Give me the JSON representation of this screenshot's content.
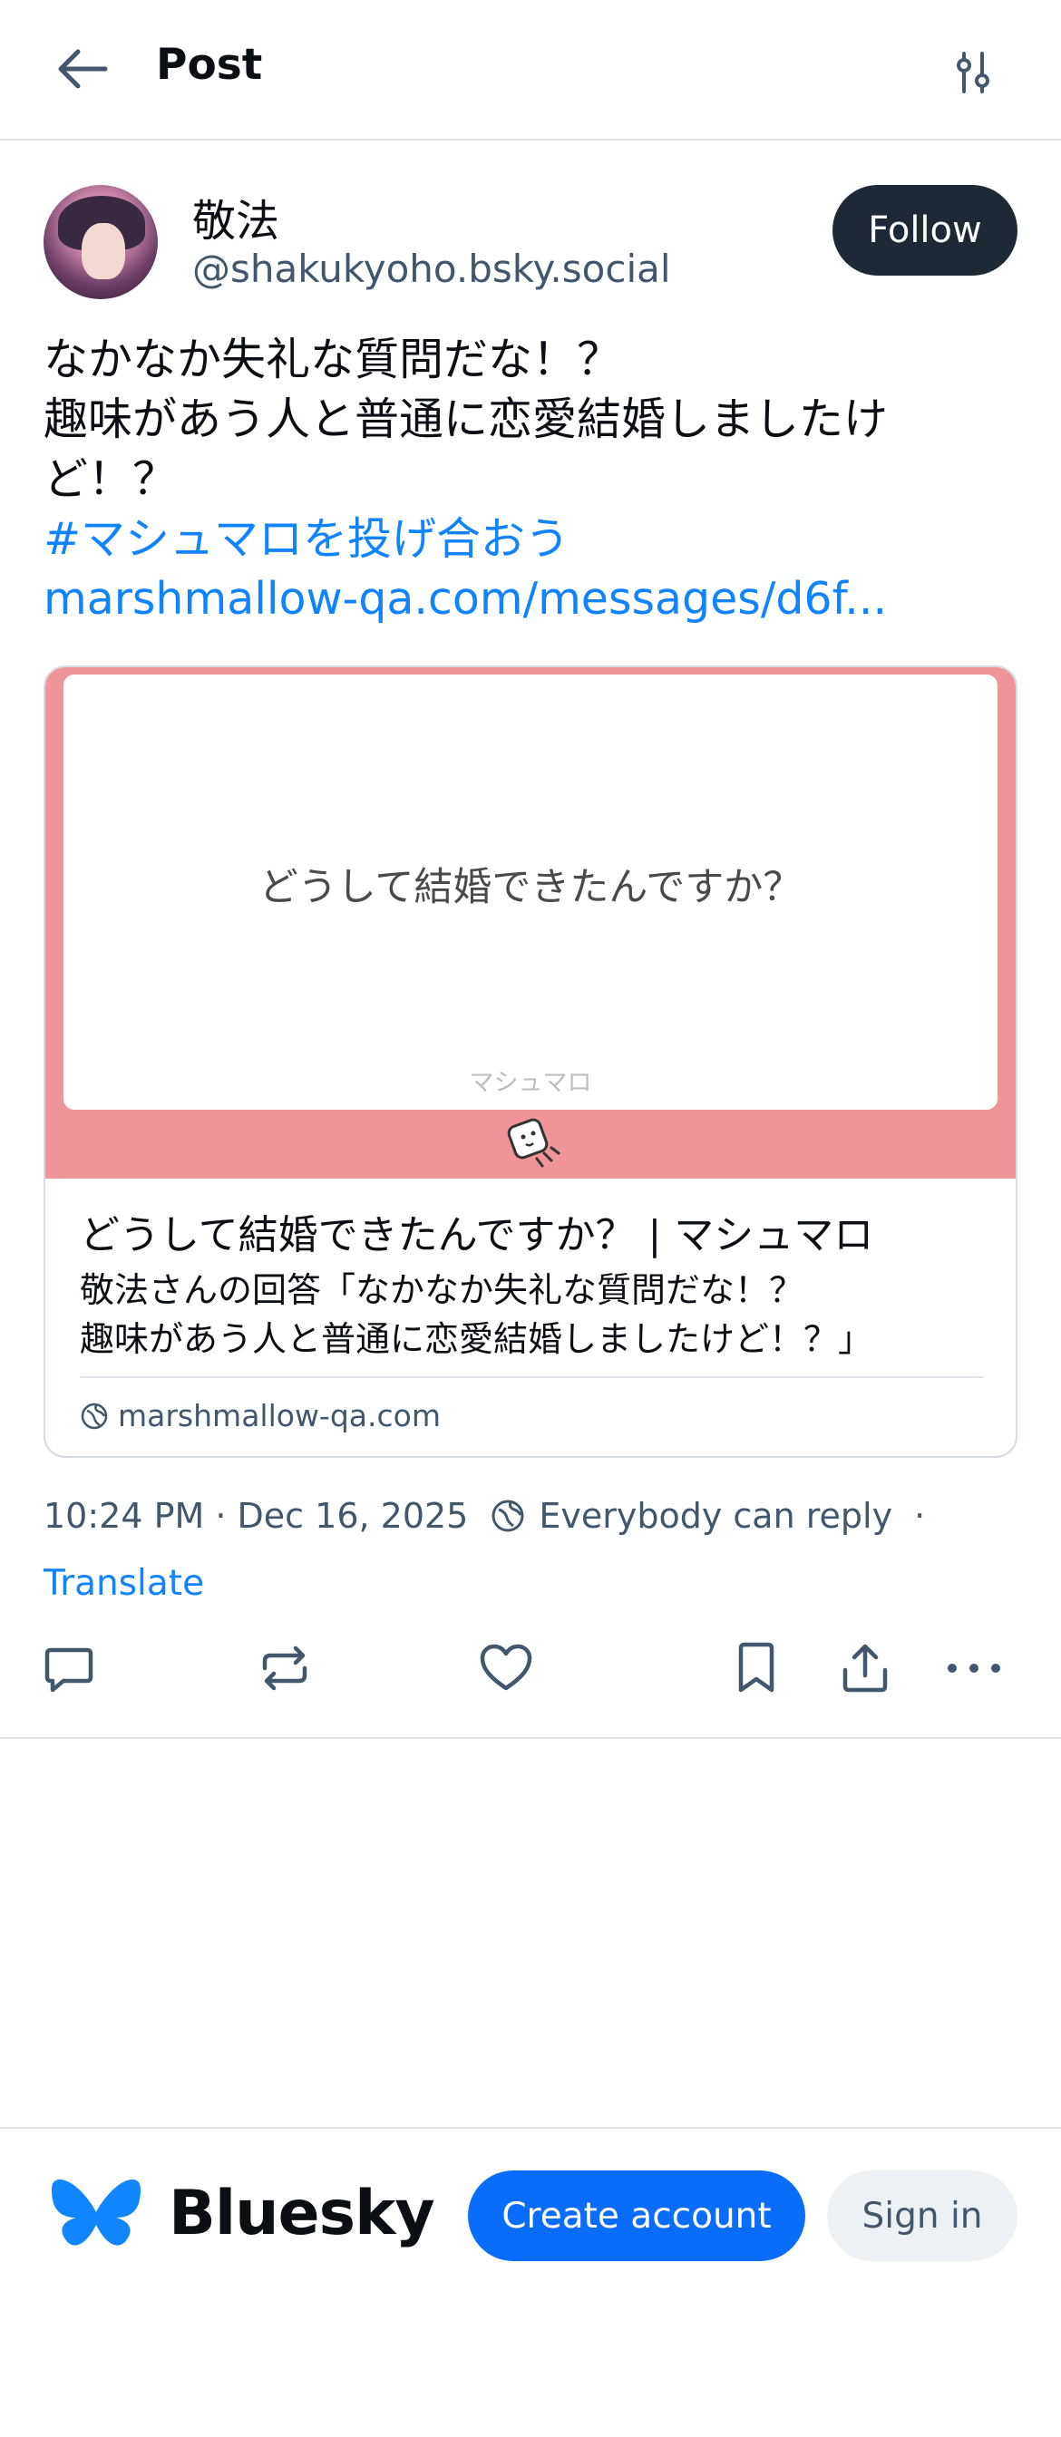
{
  "header": {
    "title": "Post",
    "back_icon": "arrow-left-icon",
    "filter_icon": "sliders-icon"
  },
  "author": {
    "display_name": "敬法",
    "handle": "@shakukyoho.bsky.social",
    "follow_label": "Follow"
  },
  "post": {
    "lines": [
      "なかなか失礼な質問だな！？",
      "趣味があう人と普通に恋愛結婚しましたけ",
      "ど！？"
    ],
    "hashtag": "#マシュマロを投げ合おう",
    "link": "marshmallow-qa.com/messages/d6f..."
  },
  "link_card": {
    "image_question": "どうして結婚できたんですか？",
    "image_brand": "マシュマロ",
    "title": "どうして結婚できたんですか？ | マシュマロ",
    "description_lines": [
      "敬法さんの回答「なかなか失礼な質問だな！？",
      "趣味があう人と普通に恋愛結婚しましたけど！？」"
    ],
    "domain": "marshmallow-qa.com"
  },
  "meta": {
    "timestamp": "10:24 PM · Dec 16, 2025",
    "reply_setting": "Everybody can reply",
    "separator": "·",
    "translate_label": "Translate"
  },
  "actions": {
    "reply_icon": "reply-icon",
    "repost_icon": "repost-icon",
    "like_icon": "heart-icon",
    "bookmark_icon": "bookmark-icon",
    "share_icon": "share-icon",
    "more_icon": "more-icon"
  },
  "footer": {
    "brand": "Bluesky",
    "create_label": "Create account",
    "signin_label": "Sign in"
  },
  "colors": {
    "accent": "#1083fe",
    "primary_button": "#0a6cfb",
    "follow_button": "#1e2936",
    "card_image_bg": "#ef9497"
  }
}
